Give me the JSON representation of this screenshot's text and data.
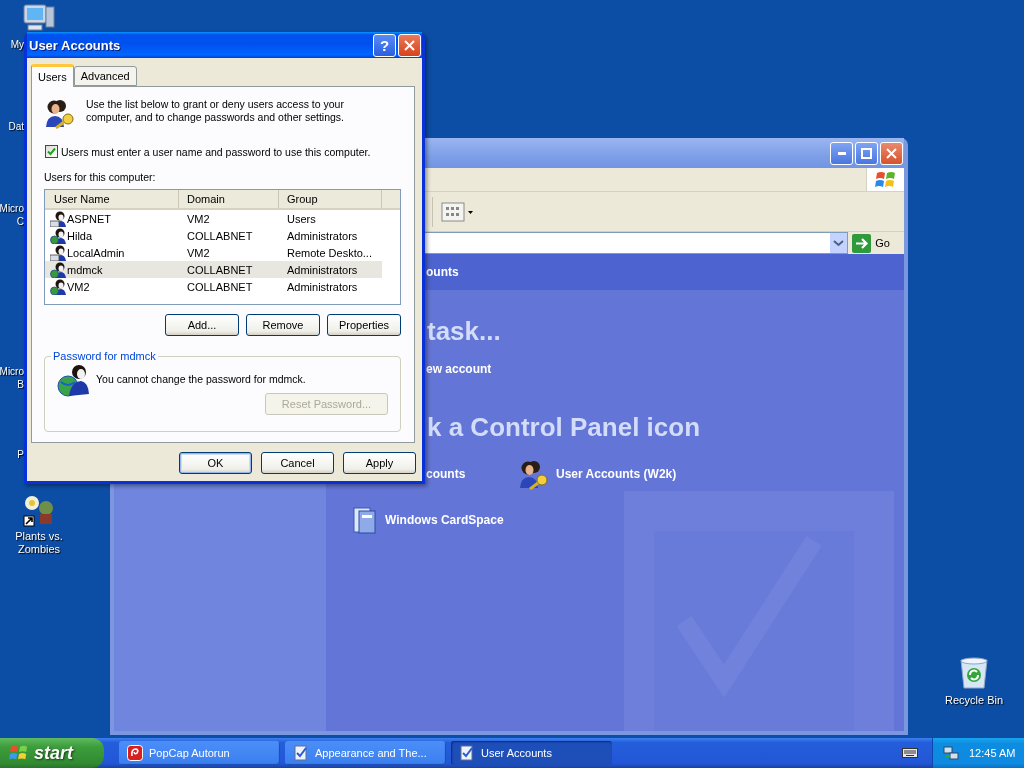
{
  "desktop": {
    "icons": [
      {
        "kind": "computer",
        "lines": [
          "My"
        ]
      },
      {
        "kind": "hidden",
        "lines": [
          "Dat"
        ]
      },
      {
        "kind": "hidden",
        "lines": [
          "Micro",
          "C"
        ]
      },
      {
        "kind": "hidden",
        "lines": [
          "Micro",
          "B"
        ]
      },
      {
        "kind": "hidden",
        "lines": [
          "P"
        ]
      },
      {
        "kind": "plants",
        "lines": [
          "Plants vs.",
          "Zombies"
        ]
      },
      {
        "kind": "recycle",
        "lines": [
          "Recycle Bin"
        ]
      }
    ]
  },
  "control_panel": {
    "header": "ounts",
    "heading": "task...",
    "tasks": [
      "ew account"
    ],
    "icons_heading": "k a Control Panel icon",
    "go_label": "Go",
    "items": [
      {
        "kind": "hidden",
        "label": "counts"
      },
      {
        "kind": "users",
        "label": "User Accounts (W2k)"
      },
      {
        "kind": "cardspace",
        "label": "Windows CardSpace"
      }
    ]
  },
  "dialog": {
    "title": "User Accounts",
    "help_button": "?",
    "tabs": [
      {
        "label": "Users",
        "selected": true
      },
      {
        "label": "Advanced",
        "selected": false
      }
    ],
    "intro": "Use the list below to grant or deny users access to your computer, and to change passwords and other settings.",
    "require_login": {
      "label": "Users must enter a user name and password to use this computer.",
      "checked": true
    },
    "list_label": "Users for this computer:",
    "table": {
      "columns": [
        "User Name",
        "Domain",
        "Group"
      ],
      "rows": [
        {
          "kind": "local",
          "selected": false,
          "cells": [
            "ASPNET",
            "VM2",
            "Users"
          ]
        },
        {
          "kind": "domain",
          "selected": false,
          "cells": [
            "Hilda",
            "COLLABNET",
            "Administrators"
          ]
        },
        {
          "kind": "local",
          "selected": false,
          "cells": [
            "LocalAdmin",
            "VM2",
            "Remote Deskto..."
          ]
        },
        {
          "kind": "domain",
          "selected": true,
          "cells": [
            "mdmck",
            "COLLABNET",
            "Administrators"
          ]
        },
        {
          "kind": "domain",
          "selected": false,
          "cells": [
            "VM2",
            "COLLABNET",
            "Administrators"
          ]
        }
      ]
    },
    "list_buttons": [
      "Add...",
      "Remove",
      "Properties"
    ],
    "password_group": {
      "title": "Password for mdmck",
      "message": "You cannot change the password for mdmck.",
      "button": {
        "label": "Reset Password...",
        "disabled": true
      }
    },
    "buttons": [
      {
        "label": "OK",
        "default": true
      },
      {
        "label": "Cancel",
        "default": false
      },
      {
        "label": "Apply",
        "default": false
      }
    ]
  },
  "taskbar": {
    "start_label": "start",
    "clock": "12:45 AM",
    "tasks": [
      {
        "kind": "popcap",
        "label": "PopCap Autorun",
        "selected": false
      },
      {
        "kind": "panel",
        "label": "Appearance and The...",
        "selected": false
      },
      {
        "kind": "panel",
        "label": "User Accounts",
        "selected": true
      }
    ]
  }
}
